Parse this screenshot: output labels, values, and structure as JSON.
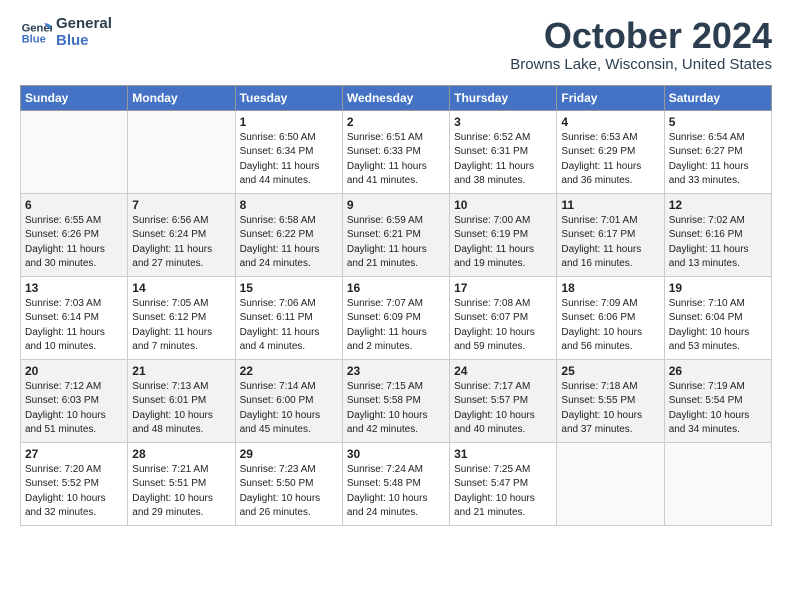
{
  "header": {
    "logo_line1": "General",
    "logo_line2": "Blue",
    "month": "October 2024",
    "location": "Browns Lake, Wisconsin, United States"
  },
  "weekdays": [
    "Sunday",
    "Monday",
    "Tuesday",
    "Wednesday",
    "Thursday",
    "Friday",
    "Saturday"
  ],
  "weeks": [
    [
      {
        "day": "",
        "info": ""
      },
      {
        "day": "",
        "info": ""
      },
      {
        "day": "1",
        "info": "Sunrise: 6:50 AM\nSunset: 6:34 PM\nDaylight: 11 hours and 44 minutes."
      },
      {
        "day": "2",
        "info": "Sunrise: 6:51 AM\nSunset: 6:33 PM\nDaylight: 11 hours and 41 minutes."
      },
      {
        "day": "3",
        "info": "Sunrise: 6:52 AM\nSunset: 6:31 PM\nDaylight: 11 hours and 38 minutes."
      },
      {
        "day": "4",
        "info": "Sunrise: 6:53 AM\nSunset: 6:29 PM\nDaylight: 11 hours and 36 minutes."
      },
      {
        "day": "5",
        "info": "Sunrise: 6:54 AM\nSunset: 6:27 PM\nDaylight: 11 hours and 33 minutes."
      }
    ],
    [
      {
        "day": "6",
        "info": "Sunrise: 6:55 AM\nSunset: 6:26 PM\nDaylight: 11 hours and 30 minutes."
      },
      {
        "day": "7",
        "info": "Sunrise: 6:56 AM\nSunset: 6:24 PM\nDaylight: 11 hours and 27 minutes."
      },
      {
        "day": "8",
        "info": "Sunrise: 6:58 AM\nSunset: 6:22 PM\nDaylight: 11 hours and 24 minutes."
      },
      {
        "day": "9",
        "info": "Sunrise: 6:59 AM\nSunset: 6:21 PM\nDaylight: 11 hours and 21 minutes."
      },
      {
        "day": "10",
        "info": "Sunrise: 7:00 AM\nSunset: 6:19 PM\nDaylight: 11 hours and 19 minutes."
      },
      {
        "day": "11",
        "info": "Sunrise: 7:01 AM\nSunset: 6:17 PM\nDaylight: 11 hours and 16 minutes."
      },
      {
        "day": "12",
        "info": "Sunrise: 7:02 AM\nSunset: 6:16 PM\nDaylight: 11 hours and 13 minutes."
      }
    ],
    [
      {
        "day": "13",
        "info": "Sunrise: 7:03 AM\nSunset: 6:14 PM\nDaylight: 11 hours and 10 minutes."
      },
      {
        "day": "14",
        "info": "Sunrise: 7:05 AM\nSunset: 6:12 PM\nDaylight: 11 hours and 7 minutes."
      },
      {
        "day": "15",
        "info": "Sunrise: 7:06 AM\nSunset: 6:11 PM\nDaylight: 11 hours and 4 minutes."
      },
      {
        "day": "16",
        "info": "Sunrise: 7:07 AM\nSunset: 6:09 PM\nDaylight: 11 hours and 2 minutes."
      },
      {
        "day": "17",
        "info": "Sunrise: 7:08 AM\nSunset: 6:07 PM\nDaylight: 10 hours and 59 minutes."
      },
      {
        "day": "18",
        "info": "Sunrise: 7:09 AM\nSunset: 6:06 PM\nDaylight: 10 hours and 56 minutes."
      },
      {
        "day": "19",
        "info": "Sunrise: 7:10 AM\nSunset: 6:04 PM\nDaylight: 10 hours and 53 minutes."
      }
    ],
    [
      {
        "day": "20",
        "info": "Sunrise: 7:12 AM\nSunset: 6:03 PM\nDaylight: 10 hours and 51 minutes."
      },
      {
        "day": "21",
        "info": "Sunrise: 7:13 AM\nSunset: 6:01 PM\nDaylight: 10 hours and 48 minutes."
      },
      {
        "day": "22",
        "info": "Sunrise: 7:14 AM\nSunset: 6:00 PM\nDaylight: 10 hours and 45 minutes."
      },
      {
        "day": "23",
        "info": "Sunrise: 7:15 AM\nSunset: 5:58 PM\nDaylight: 10 hours and 42 minutes."
      },
      {
        "day": "24",
        "info": "Sunrise: 7:17 AM\nSunset: 5:57 PM\nDaylight: 10 hours and 40 minutes."
      },
      {
        "day": "25",
        "info": "Sunrise: 7:18 AM\nSunset: 5:55 PM\nDaylight: 10 hours and 37 minutes."
      },
      {
        "day": "26",
        "info": "Sunrise: 7:19 AM\nSunset: 5:54 PM\nDaylight: 10 hours and 34 minutes."
      }
    ],
    [
      {
        "day": "27",
        "info": "Sunrise: 7:20 AM\nSunset: 5:52 PM\nDaylight: 10 hours and 32 minutes."
      },
      {
        "day": "28",
        "info": "Sunrise: 7:21 AM\nSunset: 5:51 PM\nDaylight: 10 hours and 29 minutes."
      },
      {
        "day": "29",
        "info": "Sunrise: 7:23 AM\nSunset: 5:50 PM\nDaylight: 10 hours and 26 minutes."
      },
      {
        "day": "30",
        "info": "Sunrise: 7:24 AM\nSunset: 5:48 PM\nDaylight: 10 hours and 24 minutes."
      },
      {
        "day": "31",
        "info": "Sunrise: 7:25 AM\nSunset: 5:47 PM\nDaylight: 10 hours and 21 minutes."
      },
      {
        "day": "",
        "info": ""
      },
      {
        "day": "",
        "info": ""
      }
    ]
  ]
}
